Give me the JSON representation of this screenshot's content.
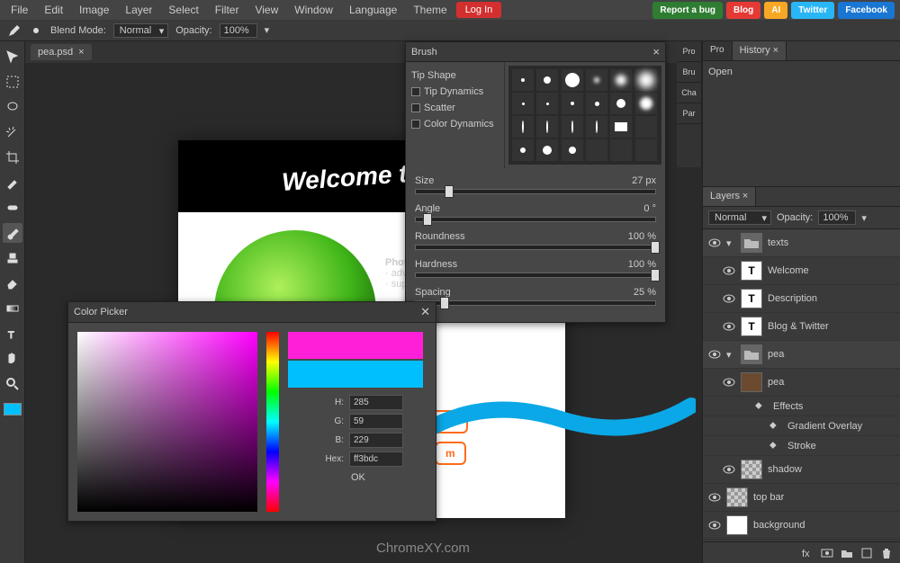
{
  "menu": [
    "File",
    "Edit",
    "Image",
    "Layer",
    "Select",
    "Filter",
    "View",
    "Window",
    "Language",
    "Theme"
  ],
  "login": "Log In",
  "social": {
    "report": "Report a bug",
    "blog": "Blog",
    "ai": "AI",
    "twitter": "Twitter",
    "facebook": "Facebook"
  },
  "optbar": {
    "blend_label": "Blend Mode:",
    "blend_value": "Normal",
    "opacity_label": "Opacity:",
    "opacity_value": "100%"
  },
  "tab": {
    "name": "pea.psd",
    "close": "×"
  },
  "canvas": {
    "welcome": "Welcome to Ph",
    "desc_title": "Photopea g",
    "desc1": "· advan",
    "desc2": "· suppo"
  },
  "orange_btns": {
    "b1": "om",
    "b2": "m"
  },
  "watermark": "ChromeXY.com",
  "brush": {
    "title": "Brush",
    "tabs": [
      "Tip Shape",
      "Tip Dynamics",
      "Scatter",
      "Color Dynamics"
    ],
    "sliders": [
      {
        "label": "Size",
        "value": "27 px",
        "pos": 12
      },
      {
        "label": "Angle",
        "value": "0 °",
        "pos": 3
      },
      {
        "label": "Roundness",
        "value": "100 %",
        "pos": 98
      },
      {
        "label": "Hardness",
        "value": "100 %",
        "pos": 98
      },
      {
        "label": "Spacing",
        "value": "25 %",
        "pos": 10
      }
    ]
  },
  "color_picker": {
    "title": "Color Picker",
    "rows": [
      {
        "l": "H:",
        "v": "285"
      },
      {
        "l": "G:",
        "v": "59"
      },
      {
        "l": "B:",
        "v": "229"
      },
      {
        "l": "Hex:",
        "v": "ff3bdc"
      }
    ],
    "ok": "OK"
  },
  "right": {
    "tabs": [
      "Pro",
      "History"
    ],
    "mini": [
      "Pro",
      "Bru",
      "Cha",
      "Par"
    ],
    "history_item": "Open",
    "layers_tab": "Layers",
    "blend": "Normal",
    "opacity_label": "Opacity:",
    "opacity_value": "100%",
    "layers": [
      {
        "type": "group",
        "name": "texts",
        "depth": 0
      },
      {
        "type": "text",
        "name": "Welcome",
        "depth": 1
      },
      {
        "type": "text",
        "name": "Description",
        "depth": 1
      },
      {
        "type": "text",
        "name": "Blog & Twitter",
        "depth": 1
      },
      {
        "type": "group",
        "name": "pea",
        "depth": 0
      },
      {
        "type": "img",
        "name": "pea",
        "depth": 1,
        "thumb": "brown"
      },
      {
        "type": "fx",
        "name": "Effects",
        "depth": 2
      },
      {
        "type": "fx",
        "name": "Gradient Overlay",
        "depth": 3
      },
      {
        "type": "fx",
        "name": "Stroke",
        "depth": 3
      },
      {
        "type": "img",
        "name": "shadow",
        "depth": 1,
        "thumb": "checker"
      },
      {
        "type": "img",
        "name": "top bar",
        "depth": 0,
        "thumb": "checker"
      },
      {
        "type": "img",
        "name": "background",
        "depth": 0,
        "thumb": "white"
      }
    ]
  }
}
